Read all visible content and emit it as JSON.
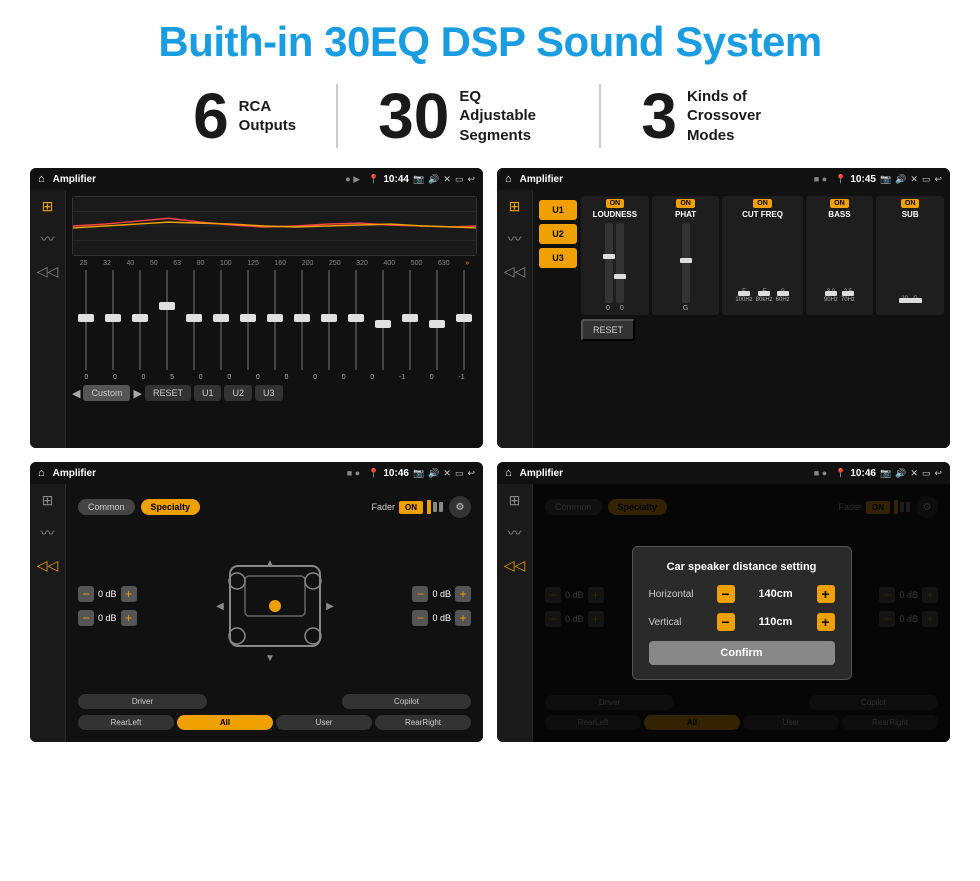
{
  "page": {
    "title": "Buith-in 30EQ DSP Sound System",
    "stats": [
      {
        "number": "6",
        "label": "RCA\nOutputs"
      },
      {
        "number": "30",
        "label": "EQ Adjustable\nSegments"
      },
      {
        "number": "3",
        "label": "Kinds of\nCrossover Modes"
      }
    ],
    "screens": [
      {
        "id": "screen1",
        "title": "Amplifier",
        "time": "10:44",
        "type": "eq",
        "eq_bands": [
          "25",
          "32",
          "40",
          "50",
          "63",
          "80",
          "100",
          "125",
          "160",
          "200",
          "250",
          "320",
          "400",
          "500",
          "630"
        ],
        "eq_values": [
          "0",
          "0",
          "0",
          "5",
          "0",
          "0",
          "0",
          "0",
          "0",
          "0",
          "0",
          "-1",
          "0",
          "-1"
        ],
        "eq_buttons": [
          "Custom",
          "RESET",
          "U1",
          "U2",
          "U3"
        ],
        "eq_curve_color": "#ff4444"
      },
      {
        "id": "screen2",
        "title": "Amplifier",
        "time": "10:45",
        "type": "crossover",
        "presets": [
          "U1",
          "U2",
          "U3"
        ],
        "controls": [
          "LOUDNESS",
          "PHAT",
          "CUT FREQ",
          "BASS",
          "SUB"
        ],
        "reset_label": "RESET"
      },
      {
        "id": "screen3",
        "title": "Amplifier",
        "time": "10:46",
        "type": "fader",
        "tabs": [
          "Common",
          "Specialty"
        ],
        "fader_label": "Fader",
        "on_label": "ON",
        "db_controls": [
          "0 dB",
          "0 dB",
          "0 dB",
          "0 dB"
        ],
        "buttons": [
          "Driver",
          "",
          "Copilot",
          "RearLeft",
          "All",
          "User",
          "RearRight"
        ]
      },
      {
        "id": "screen4",
        "title": "Amplifier",
        "time": "10:46",
        "type": "fader_dialog",
        "tabs": [
          "Common",
          "Specialty"
        ],
        "dialog": {
          "title": "Car speaker distance setting",
          "horizontal_label": "Horizontal",
          "horizontal_value": "140cm",
          "vertical_label": "Vertical",
          "vertical_value": "110cm",
          "confirm_label": "Confirm"
        },
        "buttons": [
          "Driver",
          "",
          "Copilot",
          "RearLeft",
          "All",
          "User",
          "RearRight"
        ]
      }
    ]
  }
}
